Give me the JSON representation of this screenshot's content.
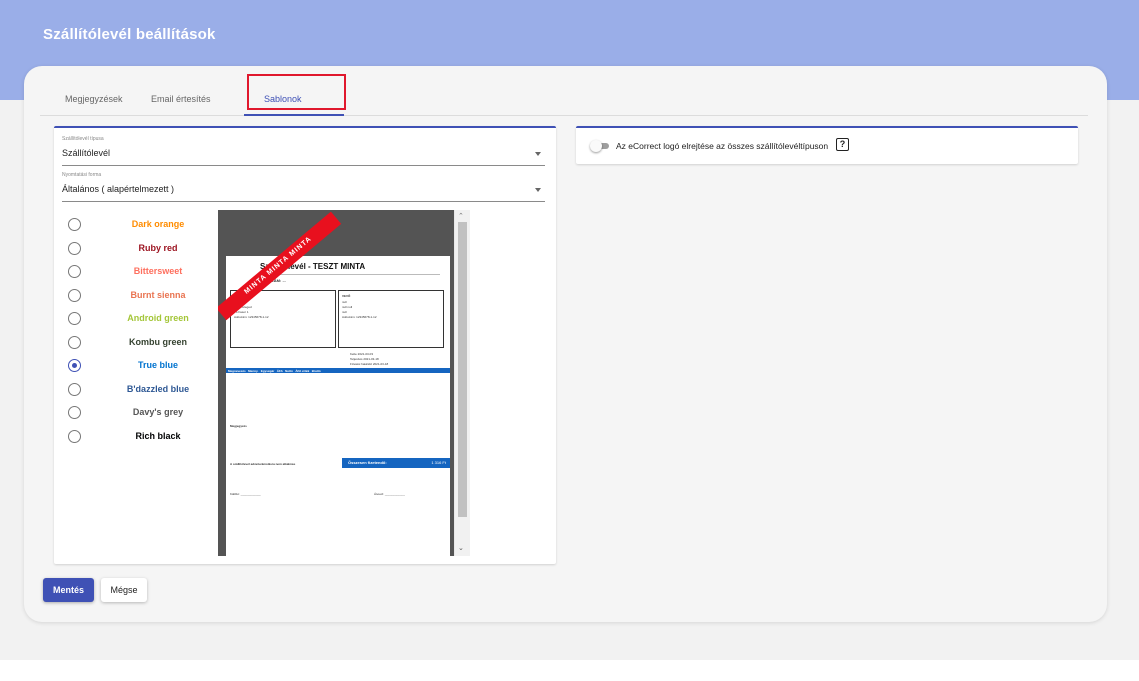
{
  "header": {
    "title": "Szállítólevél beállítások"
  },
  "tabs": [
    {
      "label": "Megjegyzések",
      "active": false
    },
    {
      "label": "Email értesítés",
      "active": false
    },
    {
      "label": "Sablonok",
      "active": true
    }
  ],
  "form": {
    "type_select": {
      "label": "Szállítólevél típusa",
      "value": "Szállítólevél"
    },
    "print_select": {
      "label": "Nyomtatási forma",
      "value": "Általános ( alapértelmezett )"
    }
  },
  "colors": [
    {
      "label": "Dark orange",
      "color": "#ff8c00",
      "selected": false
    },
    {
      "label": "Ruby red",
      "color": "#9b111e",
      "selected": false
    },
    {
      "label": "Bittersweet",
      "color": "#fe6f5e",
      "selected": false
    },
    {
      "label": "Burnt sienna",
      "color": "#e97451",
      "selected": false
    },
    {
      "label": "Android green",
      "color": "#a4c639",
      "selected": false
    },
    {
      "label": "Kombu green",
      "color": "#354230",
      "selected": false
    },
    {
      "label": "True blue",
      "color": "#0073cf",
      "selected": true
    },
    {
      "label": "B'dazzled blue",
      "color": "#2e5894",
      "selected": false
    },
    {
      "label": "Davy's grey",
      "color": "#555555",
      "selected": false
    },
    {
      "label": "Rich black",
      "color": "#010203",
      "selected": false
    }
  ],
  "preview": {
    "title": "Szállítólevél - TESZT MINTA",
    "serial": "SORSZÁM: ...",
    "banner": "MINTA MINTA MINTA",
    "seller_heading": "ELADÓ",
    "seller_lines": [
      "Eladó Kft",
      "1085 Szeged",
      "Tó Fasor 1",
      "Adószám: 12345678-1-12"
    ],
    "buyer_heading": "VEVŐ",
    "buyer_lines": [
      "null",
      "null null",
      "null",
      "Adószám: 12345678-1-12"
    ],
    "dates": [
      "Kelte 2021-03-03",
      "Teljesítés 2021-03-18",
      "Fizetési határidő 2021-03-18"
    ],
    "table_header": "Megnevezés   Menny.   Egységár   ÁFA   Nettó   ÁFA érték   Bruttó",
    "notes_label": "Megjegyzés",
    "footer_note": "A szállítólevél adóelszámolásra nem alkalmas",
    "total_label": "Összesen fizetendő:",
    "total_value": "1 316 Ft",
    "sign_left": "Kiállító: ____________",
    "sign_right": "Átvevő: ____________"
  },
  "settings": {
    "logo_toggle_label": "Az eCorrect logó elrejtése az összes szállítólevéltípuson",
    "help_icon": "?"
  },
  "buttons": {
    "save": "Mentés",
    "cancel": "Mégse"
  }
}
